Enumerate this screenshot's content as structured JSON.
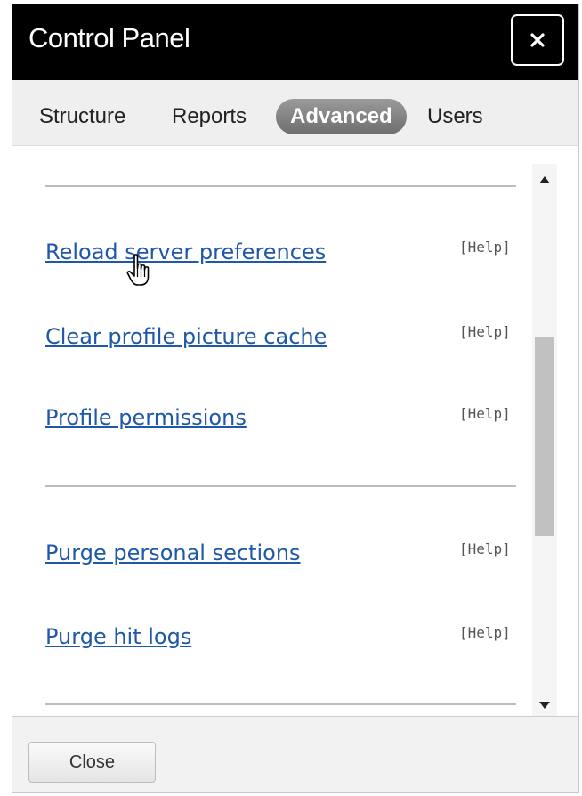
{
  "dialog": {
    "title": "Control Panel",
    "close_icon": "close-x-icon"
  },
  "tabs": [
    {
      "label": "Structure",
      "active": false
    },
    {
      "label": "Reports",
      "active": false
    },
    {
      "label": "Advanced",
      "active": true
    },
    {
      "label": "Users",
      "active": false
    }
  ],
  "actions": [
    {
      "label": "Reload server preferences",
      "help": "[Help]"
    },
    {
      "label": "Clear profile picture cache",
      "help": "[Help]"
    },
    {
      "label": "Profile permissions",
      "help": "[Help]"
    },
    {
      "label": "Purge personal sections",
      "help": "[Help]"
    },
    {
      "label": "Purge hit logs",
      "help": "[Help]"
    }
  ],
  "footer": {
    "close_label": "Close"
  },
  "colors": {
    "titlebar": "#000000",
    "link": "#1f58a8",
    "active_tab": "#7a7a7a"
  }
}
